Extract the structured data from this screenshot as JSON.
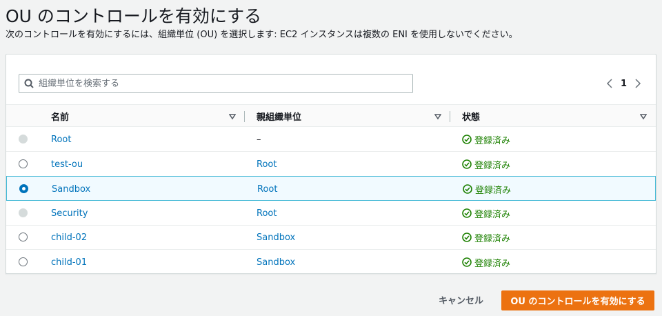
{
  "header": {
    "title": "OU のコントロールを有効にする",
    "description": "次のコントロールを有効にするには、組織単位 (OU) を選択します: EC2 インスタンスは複数の ENI を使用しないでください。"
  },
  "search": {
    "placeholder": "組織単位を検索する",
    "value": ""
  },
  "pagination": {
    "current_page": "1"
  },
  "table": {
    "columns": [
      "名前",
      "親組織単位",
      "状態"
    ],
    "rows": [
      {
        "name": "Root",
        "parent": "–",
        "status": "登録済み",
        "radio": "disabled",
        "selected": false
      },
      {
        "name": "test-ou",
        "parent": "Root",
        "status": "登録済み",
        "radio": "empty",
        "selected": false
      },
      {
        "name": "Sandbox",
        "parent": "Root",
        "status": "登録済み",
        "radio": "checked",
        "selected": true
      },
      {
        "name": "Security",
        "parent": "Root",
        "status": "登録済み",
        "radio": "disabled",
        "selected": false
      },
      {
        "name": "child-02",
        "parent": "Sandbox",
        "status": "登録済み",
        "radio": "empty",
        "selected": false
      },
      {
        "name": "child-01",
        "parent": "Sandbox",
        "status": "登録済み",
        "radio": "empty",
        "selected": false
      }
    ]
  },
  "footer": {
    "cancel_label": "キャンセル",
    "submit_label": "OU のコントロールを有効にする"
  },
  "colors": {
    "accent": "#ec7211",
    "link": "#0073bb",
    "success": "#1d8102",
    "selected_border": "#44b9d6"
  }
}
